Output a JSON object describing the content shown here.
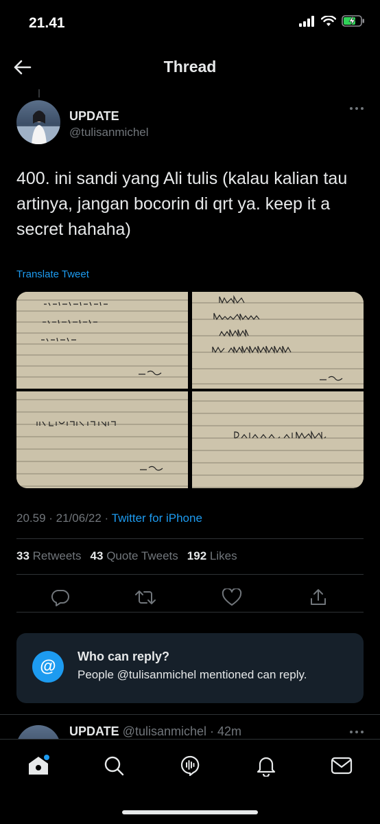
{
  "status_bar": {
    "time": "21.41"
  },
  "header": {
    "title": "Thread"
  },
  "tweet": {
    "author_name": "UPDATE",
    "author_handle": "@tulisanmichel",
    "text": "400. ini sandi yang Ali tulis (kalau kalian tau artinya, jangan bocorin di qrt ya. keep it a secret hahaha)",
    "translate_label": "Translate Tweet",
    "timestamp": "20.59 · 21/06/22 · ",
    "source": "Twitter for iPhone",
    "stats": {
      "retweets_count": "33",
      "retweets_label": "Retweets",
      "quote_count": "43",
      "quote_label": "Quote Tweets",
      "likes_count": "192",
      "likes_label": "Likes"
    },
    "images": [
      {
        "icon": "notebook-photo-icon"
      },
      {
        "icon": "notebook-photo-icon"
      },
      {
        "icon": "notebook-photo-icon"
      },
      {
        "icon": "notebook-photo-icon"
      }
    ]
  },
  "reply_restriction": {
    "title": "Who can reply?",
    "description": "People @tulisanmichel mentioned can reply.",
    "icon_glyph": "@"
  },
  "next_tweet": {
    "author_name": "UPDATE",
    "author_handle_time": " @tulisanmichel · 42m"
  },
  "colors": {
    "accent": "#1d9bf0",
    "background": "#000000",
    "card": "#16202a",
    "muted": "#71767b"
  }
}
